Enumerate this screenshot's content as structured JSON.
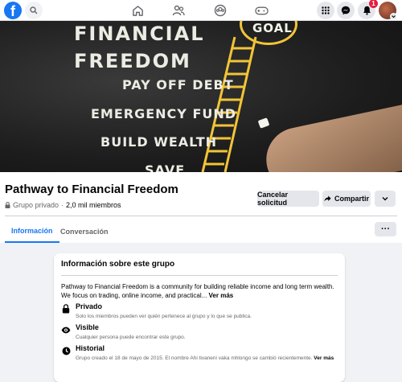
{
  "topbar": {
    "logo_letter": "f",
    "notifications_count": "1"
  },
  "cover": {
    "goal": "GOAL",
    "line1": "FINANCIAL",
    "line2": "FREEDOM",
    "line3": "PAY OFF DEBT",
    "line4": "EMERGENCY FUND",
    "line5": "BUILD WEALTH",
    "line6": "SAVE"
  },
  "group": {
    "title": "Pathway to Financial Freedom",
    "privacy": "Grupo privado",
    "separator": "·",
    "members": "2,0 mil miembros"
  },
  "actions": {
    "cancel_request": "Cancelar solicitud",
    "share": "Compartir"
  },
  "tabs": [
    {
      "label": "Información"
    },
    {
      "label": "Conversación"
    }
  ],
  "about": {
    "title": "Información sobre este grupo",
    "description": "Pathway to Financial Freedom is a community for building reliable income and long term wealth. We focus on trading, online income, and practical...",
    "see_more": "Ver más",
    "items": [
      {
        "title": "Privado",
        "text": "Solo los miembros pueden ver quién pertenece al grupo y lo que se publica.",
        "icon": "lock-icon"
      },
      {
        "title": "Visible",
        "text": "Cualquier persona puede encontrar este grupo.",
        "icon": "eye-icon"
      },
      {
        "title": "Historial",
        "text": "Grupo creado el 18 de mayo de 2015. El nombre Ahi tivaneni vaka mhlongo se cambió recientemente.",
        "more": "Ver más",
        "icon": "calendar-icon"
      }
    ]
  },
  "colors": {
    "brand": "#1877f2",
    "badge": "#e41e3f",
    "ladder": "#f2c437"
  }
}
